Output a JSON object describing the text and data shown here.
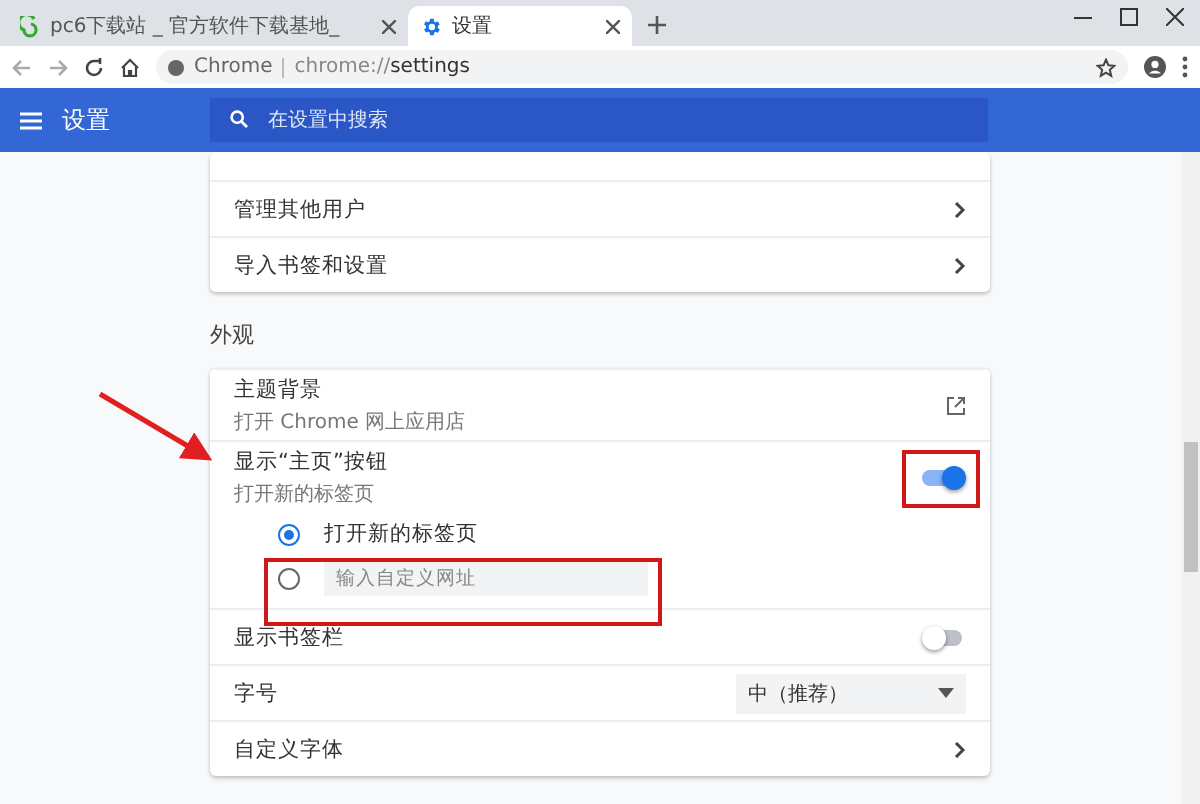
{
  "tabs": [
    {
      "title": "pc6下载站 _ 官方软件下载基地_",
      "selected": false
    },
    {
      "title": "设置",
      "selected": true
    }
  ],
  "toolbar": {
    "scheme": "Chrome",
    "url_host": "chrome://",
    "url_path": "settings"
  },
  "header": {
    "title": "设置",
    "search": {
      "placeholder": "在设置中搜索"
    }
  },
  "people_rows": [
    {
      "label": "管理其他用户"
    },
    {
      "label": "导入书签和设置"
    }
  ],
  "appearance": {
    "title": "外观",
    "rows": [
      {
        "kind": "link",
        "label": "主题背景",
        "sublabel": "打开 Chrome 网上应用店"
      },
      {
        "kind": "toggle",
        "label": "显示“主页”按钮",
        "sublabel": "打开新的标签页",
        "on": true,
        "options": [
          {
            "label": "打开新的标签页",
            "selected": true
          },
          {
            "placeholder": "输入自定义网址",
            "selected": false
          }
        ]
      },
      {
        "kind": "toggle",
        "label": "显示书签栏",
        "on": false
      },
      {
        "kind": "select",
        "label": "字号",
        "value": "中（推荐）"
      },
      {
        "kind": "nav",
        "label": "自定义字体"
      }
    ]
  }
}
